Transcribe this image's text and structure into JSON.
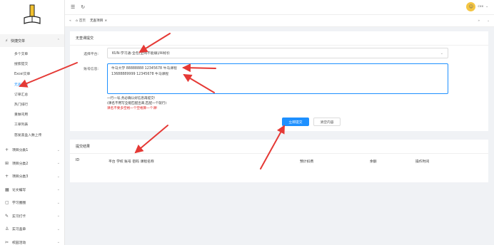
{
  "sidebar": {
    "top_menu": {
      "label": "快捷交单"
    },
    "sub_items": [
      {
        "label": "多个交单"
      },
      {
        "label": "搜索提交"
      },
      {
        "label": "Excel交单"
      },
      {
        "label": "无查项目"
      },
      {
        "label": "订单汇总"
      },
      {
        "label": "热门排行"
      },
      {
        "label": "重做司用"
      },
      {
        "label": "工单列表"
      },
      {
        "label": "怒发黑盒入数上传"
      }
    ],
    "groups": [
      {
        "label": "项目分类1",
        "icon": "+"
      },
      {
        "label": "项目分类2",
        "icon": "⊞"
      },
      {
        "label": "项目分类3",
        "icon": "+"
      },
      {
        "label": "论文编写",
        "icon": "▦"
      },
      {
        "label": "学习圈圈",
        "icon": "▢"
      },
      {
        "label": "实习打卡",
        "icon": "✎"
      },
      {
        "label": "实习盖章",
        "icon": "♙"
      },
      {
        "label": "校园活动",
        "icon": "✂"
      }
    ]
  },
  "topbar": {
    "user_name": "cxx"
  },
  "tabs": {
    "home": "首页",
    "current": "无查项目"
  },
  "form": {
    "title": "无查课提交",
    "platform_label": "选择平台:",
    "platform_value": "KUN-学习通-全包(全网不能填)/AI标价",
    "account_label": "账号信息:",
    "account_value": "牛马大学 88888888 12345678 牛马课程\n13688889999 12345678 牛马课程",
    "hint1": "一行一号,务必确认好信息再提交!",
    "hint2": "(课名不用写全能匹配出来,匹配一个就行)",
    "hint3": "课名不要多空格一个空格算一个课!",
    "submit_label": "立即提交",
    "clear_label": "清空内容"
  },
  "results": {
    "title": "提交结果",
    "columns": [
      "ID",
      "平台 学校 账号 密码 课程名称",
      "预计扣费",
      "余额",
      "操作时间"
    ]
  }
}
